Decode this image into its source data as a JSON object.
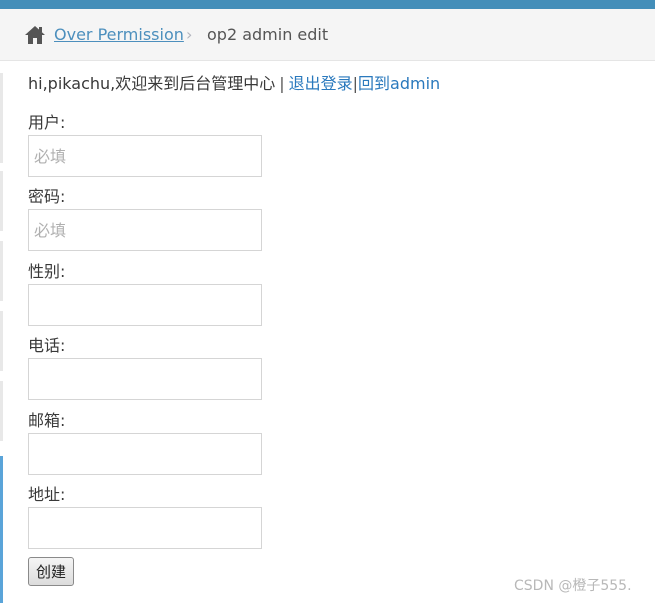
{
  "breadcrumb": {
    "link_label": "Over Permission",
    "separator": "›",
    "current": "op2 admin edit"
  },
  "welcome": {
    "text": "hi,pikachu,欢迎来到后台管理中心",
    "separator": "|",
    "logout_label": "退出登录",
    "separator2": "|",
    "back_label": "回到admin"
  },
  "form": {
    "fields": [
      {
        "label": "用户:",
        "placeholder": "必填",
        "value": ""
      },
      {
        "label": "密码:",
        "placeholder": "必填",
        "value": ""
      },
      {
        "label": "性别:",
        "placeholder": "",
        "value": ""
      },
      {
        "label": "电话:",
        "placeholder": "",
        "value": ""
      },
      {
        "label": "邮箱:",
        "placeholder": "",
        "value": ""
      },
      {
        "label": "地址:",
        "placeholder": "",
        "value": ""
      }
    ],
    "submit_label": "创建"
  },
  "watermark": "CSDN @橙子555.",
  "colors": {
    "topbar": "#438eb9",
    "link": "#2a79bd",
    "breadcrumb_bg": "#f5f5f5",
    "left_accent": "#5aa4d9"
  },
  "icons": {
    "home": "home-icon",
    "separator": "chevron-right-icon"
  }
}
